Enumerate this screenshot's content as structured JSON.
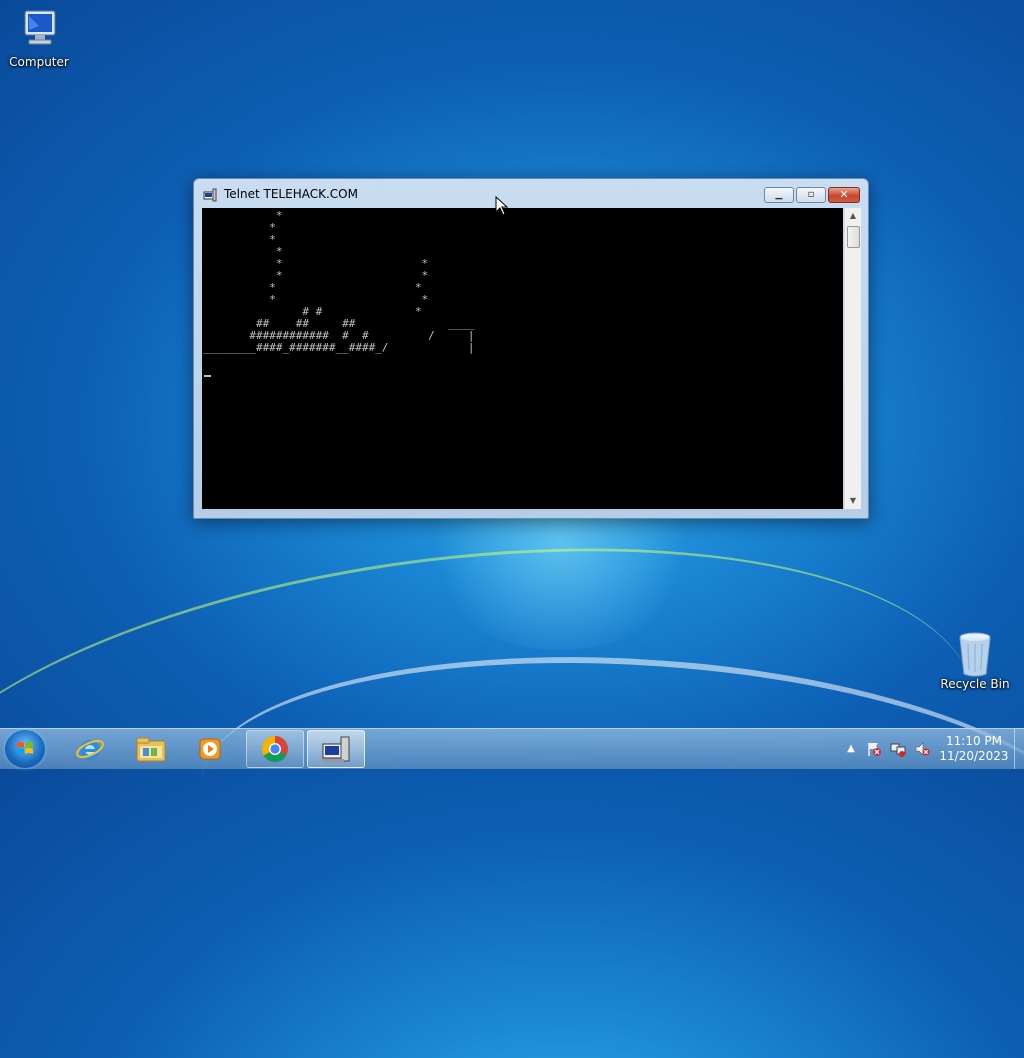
{
  "desktop": {
    "icons": [
      {
        "label": "Computer"
      },
      {
        "label": "Recycle Bin"
      }
    ]
  },
  "window": {
    "title": "Telnet TELEHACK.COM",
    "buttons": {
      "minimize": "▭",
      "maximize": "▢",
      "close": "✕"
    },
    "console_lines": [
      "           *",
      "          *",
      "          *",
      "           *",
      "           *                     *",
      "           *                     *",
      "          *                     *",
      "          *                      *",
      "               # #              *",
      "        ##    ##     ##              ____",
      "       ############  #  #         /     |",
      "________####_#######__####_/            |"
    ]
  },
  "taskbar": {
    "items": [
      {
        "name": "internet-explorer"
      },
      {
        "name": "windows-explorer"
      },
      {
        "name": "media-player"
      },
      {
        "name": "chrome"
      },
      {
        "name": "telnet"
      }
    ],
    "tray": {
      "show_hidden": "▲",
      "time": "11:10 PM",
      "date": "11/20/2023"
    }
  },
  "colors": {
    "console_bg": "#000000",
    "console_fg": "#c0c0c0",
    "close_button": "#c6472e"
  }
}
